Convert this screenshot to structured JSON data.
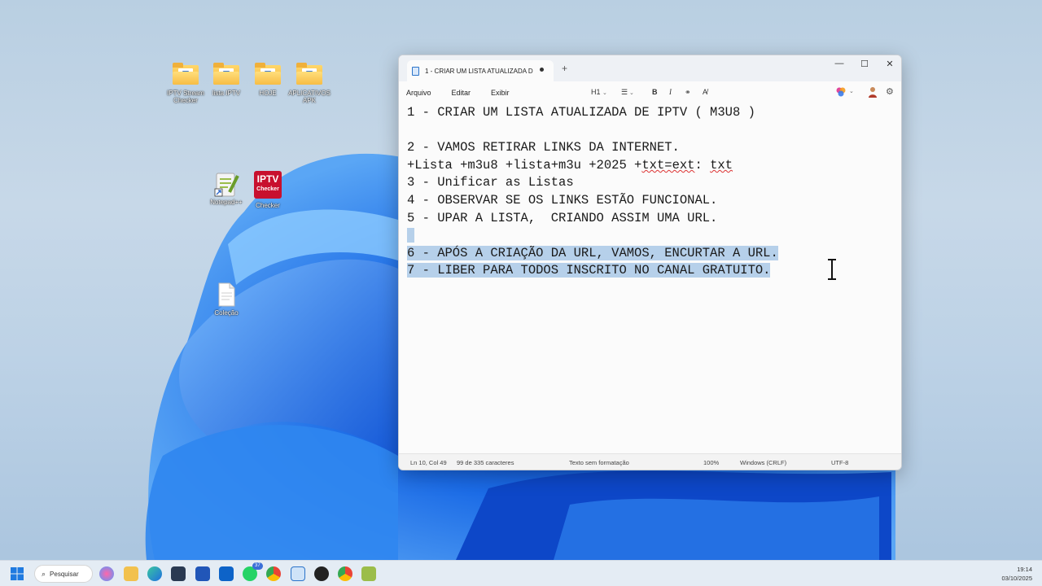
{
  "desktop": {
    "icons": [
      {
        "label": "IPTV Stream Checker"
      },
      {
        "label": "lista IPTV"
      },
      {
        "label": "HOJE"
      },
      {
        "label": "APLICATIVOS APK"
      },
      {
        "label": "Notepad++"
      },
      {
        "label": "Checker"
      },
      {
        "label": "Coleção"
      }
    ],
    "iptv_logo_top": "IPTV",
    "iptv_logo_bottom": "Checker"
  },
  "window": {
    "tab_title": "1 - CRIAR UM LISTA ATUALIZADA D",
    "new_tab": "+",
    "minimize": "—",
    "maximize": "☐",
    "close": "✕",
    "menu": {
      "file": "Arquivo",
      "edit": "Editar",
      "view": "Exibir"
    },
    "toolbar": {
      "heading": "H1",
      "bold": "B",
      "italic": "I"
    },
    "lines": [
      {
        "text": "1 - CRIAR UM LISTA ATUALIZADA DE IPTV ( M3U8 )",
        "selected": false
      },
      {
        "text": "",
        "selected": false
      },
      {
        "text": "2 - VAMOS RETIRAR LINKS DA INTERNET.",
        "selected": false
      },
      {
        "text": "+Lista +m3u8 +lista+m3u +2025 +txt=ext: txt",
        "selected": false
      },
      {
        "text": "3 - Unificar as Listas",
        "selected": false
      },
      {
        "text": "4 - OBSERVAR SE OS LINKS ESTÃO FUNCIONAL.",
        "selected": false
      },
      {
        "text": "5 - UPAR A LISTA,  CRIANDO ASSIM UMA URL.",
        "selected": false
      },
      {
        "text": " ",
        "selected": true
      },
      {
        "text": "6 - APÓS A CRIAÇÃO DA URL, VAMOS, ENCURTAR A URL.",
        "selected": true
      },
      {
        "text": "7 - LIBER PARA TODOS INSCRITO NO CANAL GRATUITO.",
        "selected": true
      }
    ],
    "status": {
      "position": "Ln 10, Col 49",
      "chars": "99 de 335 caracteres",
      "format": "Texto sem formatação",
      "zoom": "100%",
      "line_ending": "Windows (CRLF)",
      "encoding": "UTF-8"
    }
  },
  "taskbar": {
    "search_label": "Pesquisar",
    "badge": "37",
    "time": "19:14",
    "date": "03/10/2025"
  },
  "colors": {
    "selection": "#b6d0ea",
    "accent": "#2a73c9",
    "wallpaper_blue": "#1f6fe0"
  }
}
